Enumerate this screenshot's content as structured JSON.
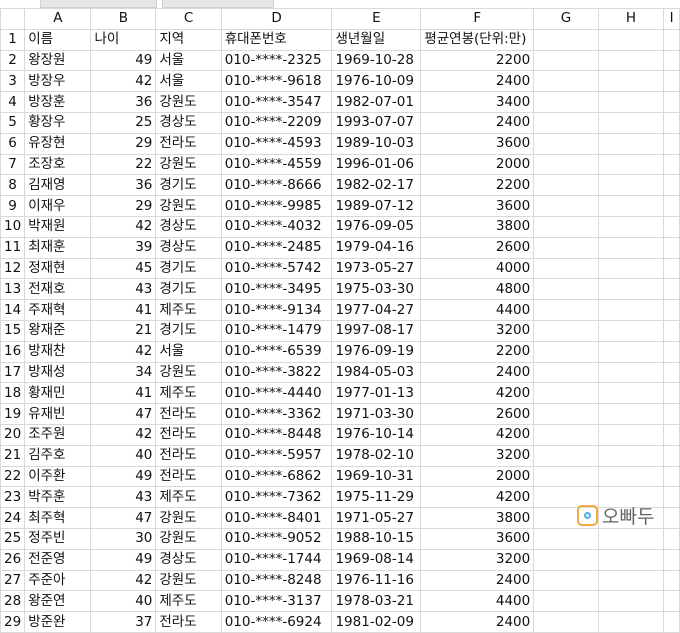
{
  "sheet": {
    "columns": [
      "A",
      "B",
      "C",
      "D",
      "E",
      "F",
      "G",
      "H",
      "I"
    ],
    "headers": {
      "name": "이름",
      "age": "나이",
      "region": "지역",
      "phone": "휴대폰번호",
      "birth": "생년월일",
      "salary": "평균연봉(단위:만)"
    },
    "rows": [
      {
        "num": "2",
        "name": "왕장원",
        "age": "49",
        "region": "서울",
        "phone": "010-****-2325",
        "birth": "1969-10-28",
        "salary": "2200"
      },
      {
        "num": "3",
        "name": "방장우",
        "age": "42",
        "region": "서울",
        "phone": "010-****-9618",
        "birth": "1976-10-09",
        "salary": "2400"
      },
      {
        "num": "4",
        "name": "방장훈",
        "age": "36",
        "region": "강원도",
        "phone": "010-****-3547",
        "birth": "1982-07-01",
        "salary": "3400"
      },
      {
        "num": "5",
        "name": "황장우",
        "age": "25",
        "region": "경상도",
        "phone": "010-****-2209",
        "birth": "1993-07-07",
        "salary": "2400"
      },
      {
        "num": "6",
        "name": "유장현",
        "age": "29",
        "region": "전라도",
        "phone": "010-****-4593",
        "birth": "1989-10-03",
        "salary": "3600"
      },
      {
        "num": "7",
        "name": "조장호",
        "age": "22",
        "region": "강원도",
        "phone": "010-****-4559",
        "birth": "1996-01-06",
        "salary": "2000"
      },
      {
        "num": "8",
        "name": "김재영",
        "age": "36",
        "region": "경기도",
        "phone": "010-****-8666",
        "birth": "1982-02-17",
        "salary": "2200"
      },
      {
        "num": "9",
        "name": "이재우",
        "age": "29",
        "region": "강원도",
        "phone": "010-****-9985",
        "birth": "1989-07-12",
        "salary": "3600"
      },
      {
        "num": "10",
        "name": "박재원",
        "age": "42",
        "region": "경상도",
        "phone": "010-****-4032",
        "birth": "1976-09-05",
        "salary": "3800"
      },
      {
        "num": "11",
        "name": "최재훈",
        "age": "39",
        "region": "경상도",
        "phone": "010-****-2485",
        "birth": "1979-04-16",
        "salary": "2600"
      },
      {
        "num": "12",
        "name": "정재현",
        "age": "45",
        "region": "경기도",
        "phone": "010-****-5742",
        "birth": "1973-05-27",
        "salary": "4000"
      },
      {
        "num": "13",
        "name": "전재호",
        "age": "43",
        "region": "경기도",
        "phone": "010-****-3495",
        "birth": "1975-03-30",
        "salary": "4800"
      },
      {
        "num": "14",
        "name": "주재혁",
        "age": "41",
        "region": "제주도",
        "phone": "010-****-9134",
        "birth": "1977-04-27",
        "salary": "4400"
      },
      {
        "num": "15",
        "name": "왕재준",
        "age": "21",
        "region": "경기도",
        "phone": "010-****-1479",
        "birth": "1997-08-17",
        "salary": "3200"
      },
      {
        "num": "16",
        "name": "방재찬",
        "age": "42",
        "region": "서울",
        "phone": "010-****-6539",
        "birth": "1976-09-19",
        "salary": "2200"
      },
      {
        "num": "17",
        "name": "방재성",
        "age": "34",
        "region": "강원도",
        "phone": "010-****-3822",
        "birth": "1984-05-03",
        "salary": "2400"
      },
      {
        "num": "18",
        "name": "황재민",
        "age": "41",
        "region": "제주도",
        "phone": "010-****-4440",
        "birth": "1977-01-13",
        "salary": "4200"
      },
      {
        "num": "19",
        "name": "유재빈",
        "age": "47",
        "region": "전라도",
        "phone": "010-****-3362",
        "birth": "1971-03-30",
        "salary": "2600"
      },
      {
        "num": "20",
        "name": "조주원",
        "age": "42",
        "region": "전라도",
        "phone": "010-****-8448",
        "birth": "1976-10-14",
        "salary": "4200"
      },
      {
        "num": "21",
        "name": "김주호",
        "age": "40",
        "region": "전라도",
        "phone": "010-****-5957",
        "birth": "1978-02-10",
        "salary": "3200"
      },
      {
        "num": "22",
        "name": "이주환",
        "age": "49",
        "region": "전라도",
        "phone": "010-****-6862",
        "birth": "1969-10-31",
        "salary": "2000"
      },
      {
        "num": "23",
        "name": "박주훈",
        "age": "43",
        "region": "제주도",
        "phone": "010-****-7362",
        "birth": "1975-11-29",
        "salary": "4200"
      },
      {
        "num": "24",
        "name": "최주혁",
        "age": "47",
        "region": "강원도",
        "phone": "010-****-8401",
        "birth": "1971-05-27",
        "salary": "3800"
      },
      {
        "num": "25",
        "name": "정주빈",
        "age": "30",
        "region": "강원도",
        "phone": "010-****-9052",
        "birth": "1988-10-15",
        "salary": "3600"
      },
      {
        "num": "26",
        "name": "전준영",
        "age": "49",
        "region": "경상도",
        "phone": "010-****-1744",
        "birth": "1969-08-14",
        "salary": "3200"
      },
      {
        "num": "27",
        "name": "주준아",
        "age": "42",
        "region": "강원도",
        "phone": "010-****-8248",
        "birth": "1976-11-16",
        "salary": "2400"
      },
      {
        "num": "28",
        "name": "왕준연",
        "age": "40",
        "region": "제주도",
        "phone": "010-****-3137",
        "birth": "1978-03-21",
        "salary": "4400"
      },
      {
        "num": "29",
        "name": "방준완",
        "age": "37",
        "region": "전라도",
        "phone": "010-****-6924",
        "birth": "1981-02-09",
        "salary": "2400"
      }
    ]
  },
  "watermark": {
    "text": "오빠두",
    "icon": "logo-icon"
  }
}
